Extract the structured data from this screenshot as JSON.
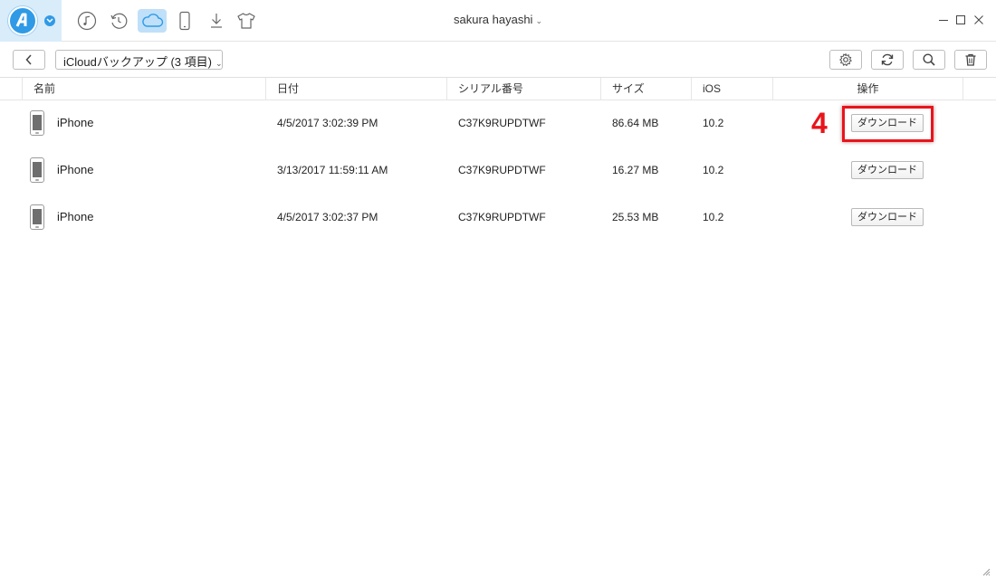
{
  "header": {
    "user_name": "sakura hayashi",
    "nav_icons": [
      "music-icon",
      "history-icon",
      "cloud-icon",
      "device-icon",
      "download-icon",
      "tshirt-icon"
    ],
    "active_nav": "cloud-icon",
    "accent_color": "#2f9ae6"
  },
  "toolbar": {
    "category_label": "iCloudバックアップ (3 項目)",
    "tools": [
      "settings-icon",
      "refresh-icon",
      "search-icon",
      "trash-icon"
    ]
  },
  "table": {
    "columns": [
      "名前",
      "日付",
      "シリアル番号",
      "サイズ",
      "iOS",
      "操作"
    ],
    "rows": [
      {
        "name": "iPhone",
        "date": "4/5/2017 3:02:39 PM",
        "serial": "C37K9RUPDTWF",
        "size": "86.64 MB",
        "ios": "10.2",
        "action": "ダウンロード"
      },
      {
        "name": "iPhone",
        "date": "3/13/2017 11:59:11 AM",
        "serial": "C37K9RUPDTWF",
        "size": "16.27 MB",
        "ios": "10.2",
        "action": "ダウンロード"
      },
      {
        "name": "iPhone",
        "date": "4/5/2017 3:02:37 PM",
        "serial": "C37K9RUPDTWF",
        "size": "25.53 MB",
        "ios": "10.2",
        "action": "ダウンロード"
      }
    ]
  },
  "annotation": {
    "step_number": "4",
    "color": "#e8141c"
  }
}
